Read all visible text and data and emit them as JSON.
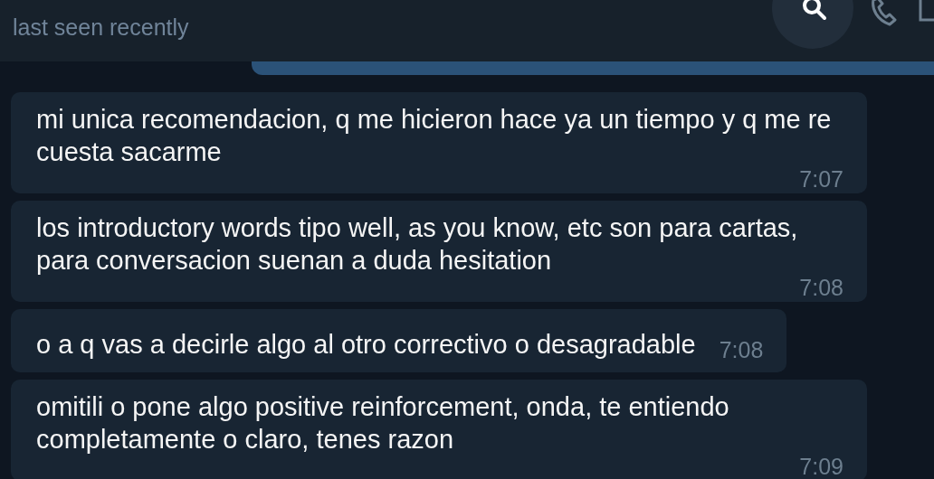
{
  "header": {
    "status": "last seen recently"
  },
  "messages": [
    {
      "text": "mi unica recomendacion, q me hicieron hace ya un tiempo y q me re cuesta sacarme",
      "time": "7:07"
    },
    {
      "text": "los introductory words tipo well, as you know, etc son para cartas, para conversacion suenan a duda hesitation",
      "time": "7:08"
    },
    {
      "text": "o a q vas a decirle algo al otro correctivo o desagradable",
      "time": "7:08"
    },
    {
      "text": "omitili o pone algo positive reinforcement, onda, te entiendo completamente o claro, tenes razon",
      "time": "7:09"
    }
  ]
}
